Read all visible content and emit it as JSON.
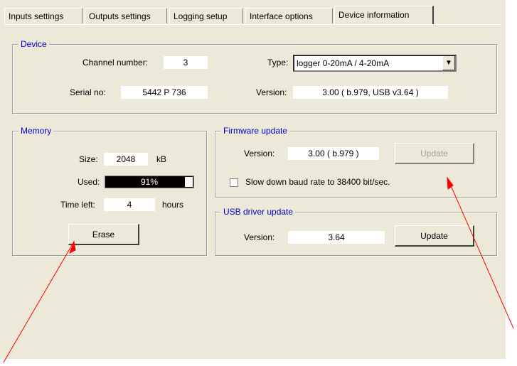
{
  "tabs": [
    "Inputs settings",
    "Outputs settings",
    "Logging setup",
    "Interface options",
    "Device information"
  ],
  "device": {
    "legend": "Device",
    "channel_label": "Channel number:",
    "channel_value": "3",
    "type_label": "Type:",
    "type_value": "logger  0-20mA / 4-20mA",
    "serial_label": "Serial no:",
    "serial_value": "5442 P 736",
    "version_label": "Version:",
    "version_value": "3.00  ( b.979, USB v3.64 )"
  },
  "memory": {
    "legend": "Memory",
    "size_label": "Size:",
    "size_value": "2048",
    "size_unit": "kB",
    "used_label": "Used:",
    "used_value": "91%",
    "used_fraction": 0.91,
    "time_label": "Time left:",
    "time_value": "4",
    "time_unit": "hours",
    "erase_label": "Erase"
  },
  "firmware": {
    "legend": "Firmware update",
    "version_label": "Version:",
    "version_value": "3.00  ( b.979 )",
    "update_label": "Update",
    "slow_label": "Slow down baud rate to 38400 bit/sec."
  },
  "usb": {
    "legend": "USB driver update",
    "version_label": "Version:",
    "version_value": "3.64",
    "update_label": "Update"
  },
  "colors": {
    "legend": "#0000cc",
    "annotation": "#ff0000"
  }
}
